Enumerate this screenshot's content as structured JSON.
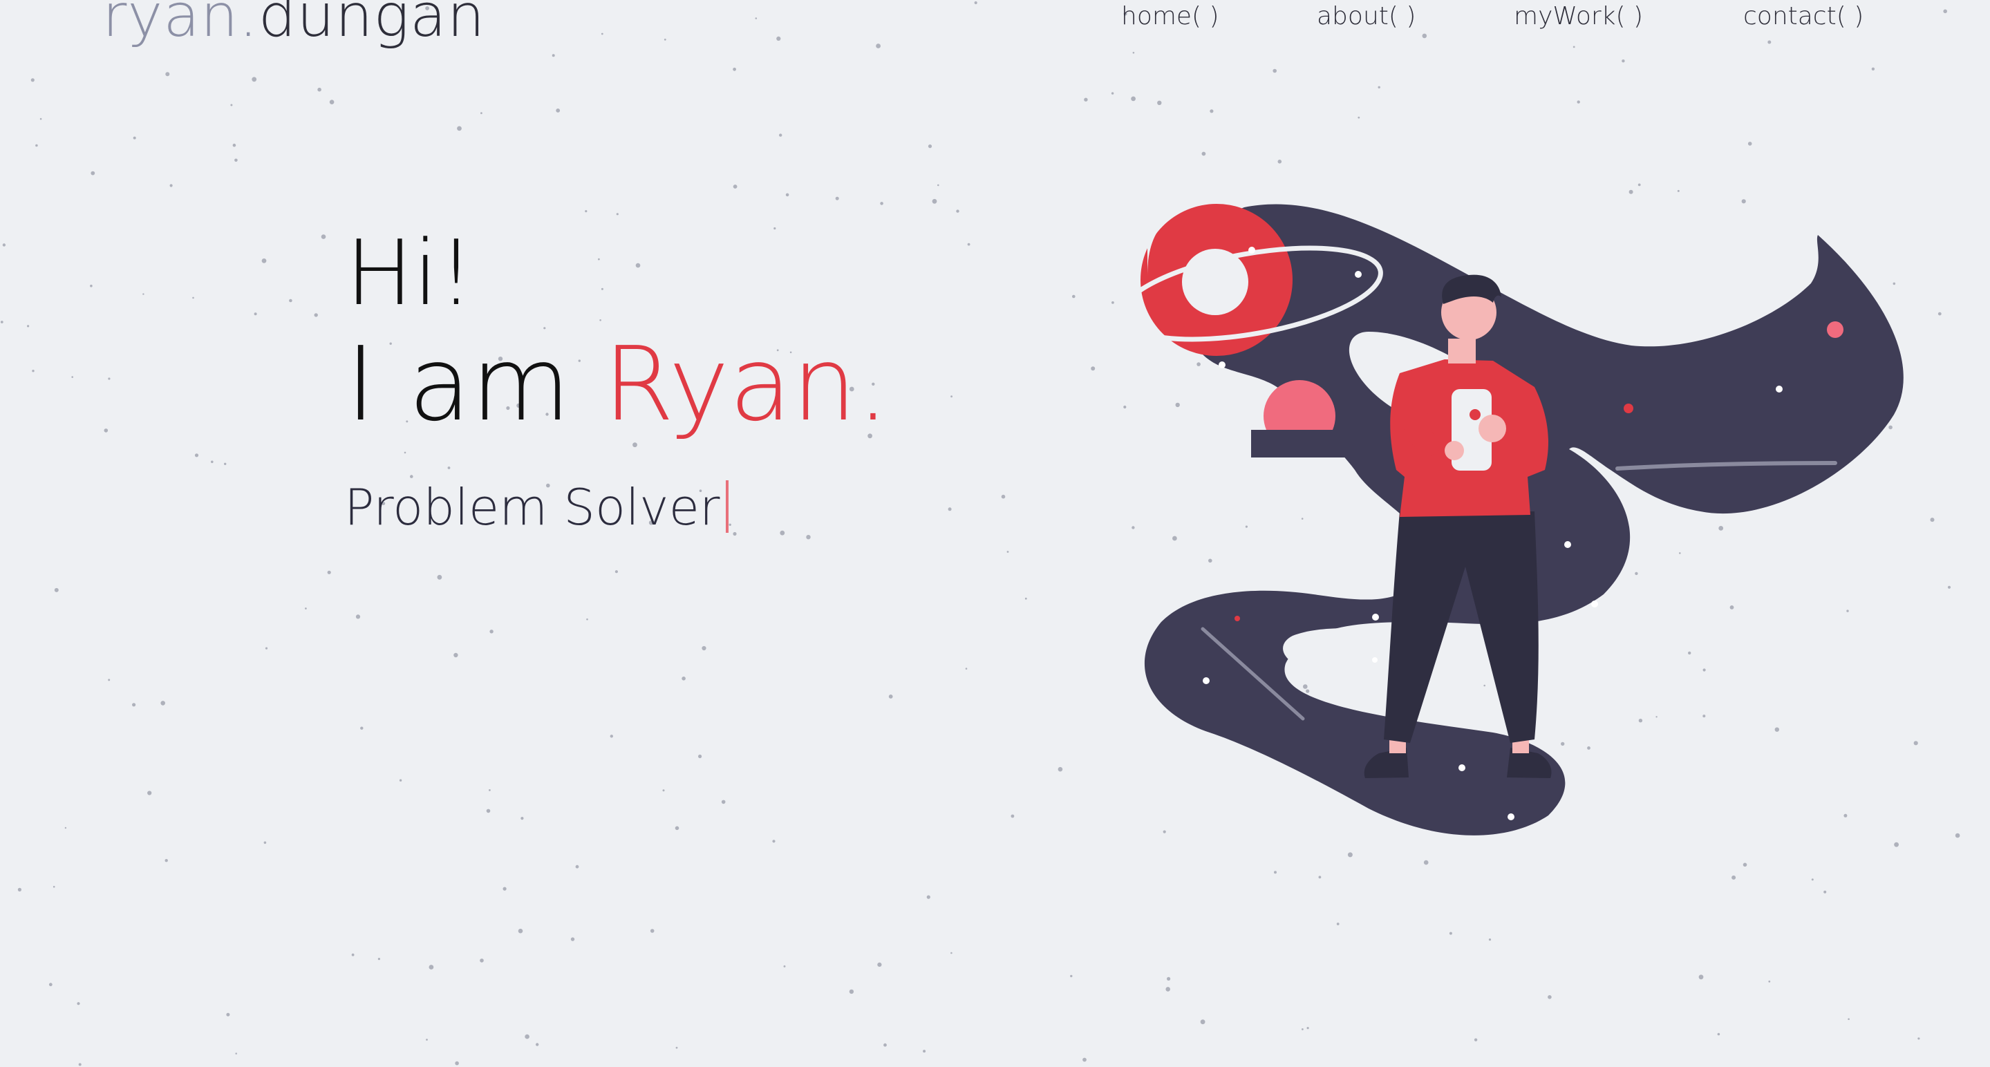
{
  "header": {
    "logo_first": "ryan.",
    "logo_last": "dungan"
  },
  "nav": {
    "items": [
      {
        "label": "home( )"
      },
      {
        "label": "about( )"
      },
      {
        "label": "myWork( )"
      },
      {
        "label": "contact( )"
      }
    ]
  },
  "hero": {
    "greeting": "Hi!",
    "intro_prefix": "I am ",
    "intro_name": "Ryan.",
    "role": "Problem Solver"
  },
  "colors": {
    "background": "#eef0f3",
    "accent": "#e03a44",
    "dark": "#3f3d56",
    "text": "#2e2e3a"
  },
  "icons": {
    "illustration": "person-holding-phone-in-space-illustration"
  }
}
